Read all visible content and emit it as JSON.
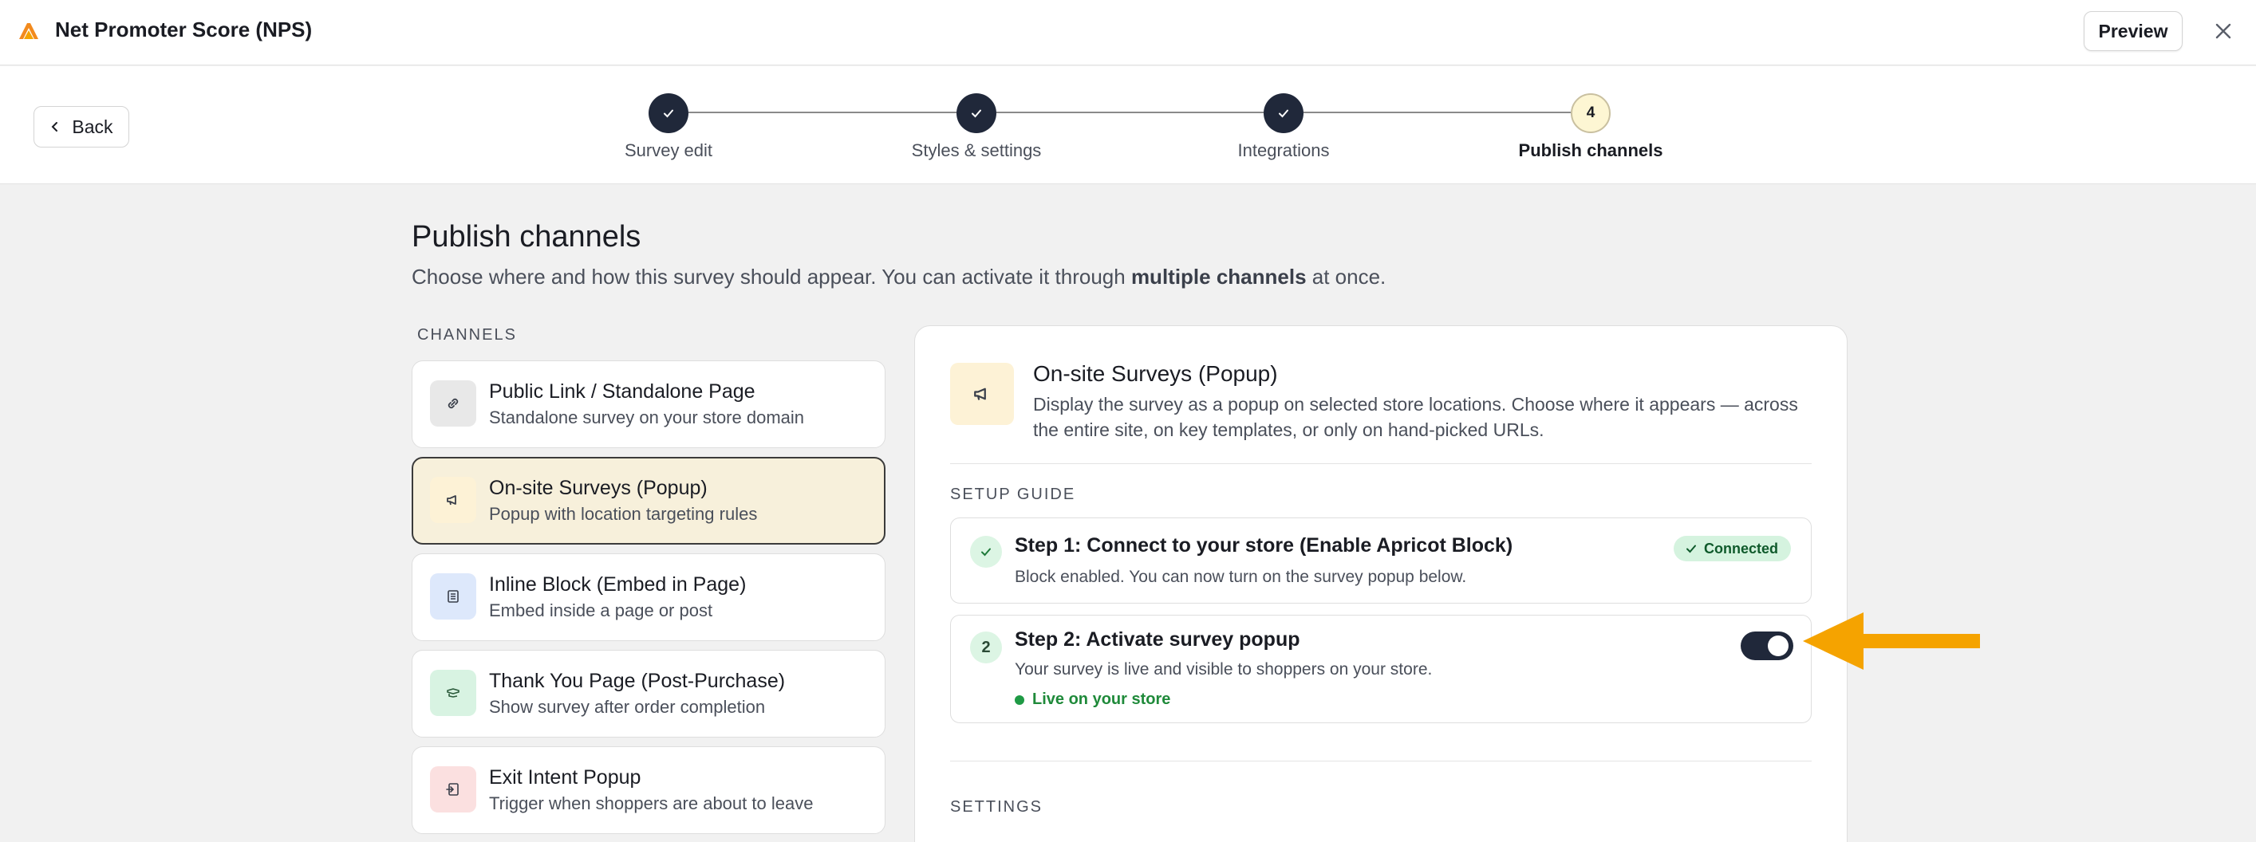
{
  "header": {
    "title": "Net Promoter Score (NPS)",
    "preview_label": "Preview",
    "logo_icon": "apricot-logo-icon",
    "close_icon": "close-icon"
  },
  "stepper": {
    "back_label": "Back",
    "steps": [
      {
        "label": "Survey edit",
        "state": "done"
      },
      {
        "label": "Styles & settings",
        "state": "done"
      },
      {
        "label": "Integrations",
        "state": "done"
      },
      {
        "label": "Publish channels",
        "state": "current",
        "number": "4"
      }
    ]
  },
  "page": {
    "title": "Publish channels",
    "subtitle_pre": "Choose where and how this survey should appear. You can activate it through ",
    "subtitle_bold": "multiple channels",
    "subtitle_post": " at once."
  },
  "channels": {
    "caption": "CHANNELS",
    "items": [
      {
        "title": "Public Link / Standalone Page",
        "desc": "Standalone survey on your store domain",
        "icon": "link-icon",
        "icon_bg": "#e8e8e8",
        "active": false
      },
      {
        "title": "On-site Surveys (Popup)",
        "desc": "Popup with location targeting rules",
        "icon": "megaphone-icon",
        "icon_bg": "#fdf2d6",
        "active": true
      },
      {
        "title": "Inline Block (Embed in Page)",
        "desc": "Embed inside a page or post",
        "icon": "embed-block-icon",
        "icon_bg": "#dde8fb",
        "active": false
      },
      {
        "title": "Thank You Page (Post-Purchase)",
        "desc": "Show survey after order completion",
        "icon": "thank-you-icon",
        "icon_bg": "#d8f3e2",
        "active": false
      },
      {
        "title": "Exit Intent Popup",
        "desc": "Trigger when shoppers are about to leave",
        "icon": "exit-icon",
        "icon_bg": "#fbe0e0",
        "active": false
      }
    ]
  },
  "detail": {
    "title": "On-site Surveys (Popup)",
    "desc": "Display the survey as a popup on selected store locations. Choose where it appears — across the entire site, on key templates, or only on hand-picked URLs.",
    "setup_caption": "SETUP GUIDE",
    "step1": {
      "title": "Step 1: Connect to your store (Enable Apricot Block)",
      "desc": "Block enabled. You can now turn on the survey popup below.",
      "badge": "Connected"
    },
    "step2": {
      "number": "2",
      "title": "Step 2: Activate survey popup",
      "desc": "Your survey is live and visible to shoppers on your store.",
      "status": "Live on your store",
      "toggle_on": true
    },
    "settings_caption": "SETTINGS"
  },
  "colors": {
    "accent_dark": "#20283a",
    "arrow": "#f5a300",
    "success": "#1f8a3a"
  }
}
